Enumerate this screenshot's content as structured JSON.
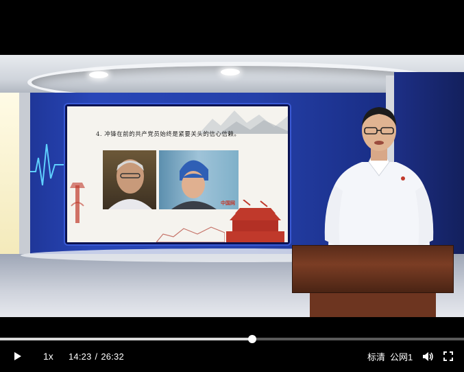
{
  "slide": {
    "caption": "4. 冲锋在前的共产党员始终是紧要关头的信心信赖。",
    "stamp": "中国网"
  },
  "controls": {
    "speed_label": "1x",
    "current_time": "14:23",
    "time_separator": "/",
    "duration": "26:32",
    "quality_label": "标清",
    "line_label": "公网1",
    "progress_fraction": 0.543
  },
  "icons": {
    "play": "play-icon",
    "volume": "volume-icon",
    "fullscreen": "fullscreen-icon"
  }
}
